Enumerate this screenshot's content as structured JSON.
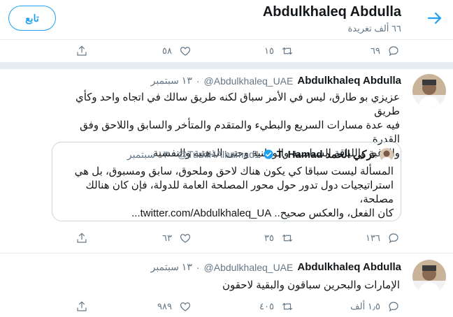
{
  "header": {
    "back_icon": "arrow-right-icon",
    "name": "Abdulkhaleq Abdulla",
    "tweet_count": "٦٦ ألف تغريدة",
    "follow_label": "تابع"
  },
  "top_actions": {
    "replies": "٦٩",
    "retweets": "١٥",
    "likes": "٥٨"
  },
  "tweet1": {
    "name": "Abdulkhaleq Abdulla",
    "handle": "@Abdulkhaleq_UAE",
    "time": "١٣ سبتمبر",
    "text": "عزيزي بو طارق، ليس في الأمر سباق لكنه طريق سالك في اتجاه واحد وكأي طريق\nفيه عدة مسارات السريع والبطيء والمتقدم والمتأخر والسابق واللاحق وفق القدرة\nوالرغبة واللياقة السياسية والوطنية وحتى الذهنية والنفسية.",
    "quote": {
      "name": "T. Hamad تركي الحمد",
      "handle": "@TurkiHAlhamad1",
      "time": "١٣ سبتمبر",
      "text": "المسألة ليست سباقا كي يكون هناك لاحق وملحوق، سابق ومسبوق، بل هي\nاستراتيجيات دول تدور حول محور المصلحة العامة للدولة، فإن كان هنالك مصلحة،\nكان الفعل، والعكس صحيح.. twitter.com/Abdulkhaleq_UA..."
    },
    "actions": {
      "replies": "١٣٦",
      "retweets": "٣٥",
      "likes": "٦٣"
    }
  },
  "tweet2": {
    "name": "Abdulkhaleq Abdulla",
    "handle": "@Abdulkhaleq_UAE",
    "time": "١٣ سبتمبر",
    "text": "الإمارات والبحرين سباقون والبقية لاحقون",
    "actions": {
      "replies": "١٫٥ ألف",
      "retweets": "٤٠٥",
      "likes": "٩٨٩"
    }
  },
  "colors": {
    "accent": "#1da1f2",
    "muted": "#657786",
    "border": "#e6ecf0"
  }
}
